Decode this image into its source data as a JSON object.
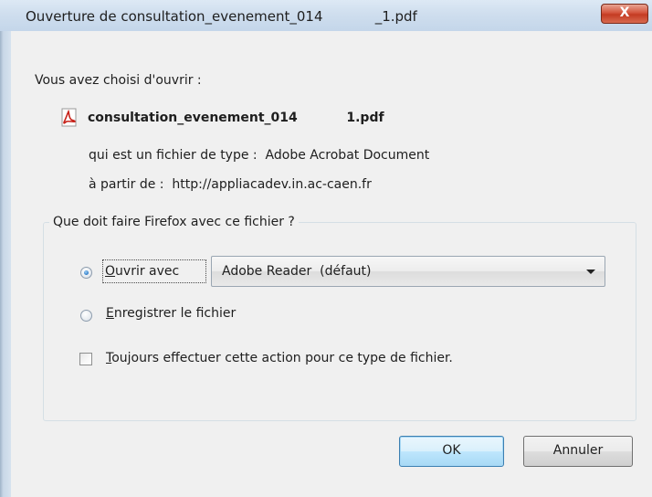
{
  "window": {
    "title": "Ouverture de consultation_evenement_014            _1.pdf",
    "close_glyph": "X"
  },
  "info": {
    "chosen_label": "Vous avez choisi d'ouvrir :",
    "file_icon": "pdf-icon",
    "filename": "consultation_evenement_014           1.pdf",
    "type_line": "qui est un fichier de type :  Adobe Acrobat Document",
    "from_line": "à partir de :  http://appliacadev.in.ac-caen.fr"
  },
  "action_group": {
    "legend": "Que doit faire Firefox avec ce fichier ?",
    "open_with": {
      "accel": "O",
      "rest": "uvrir avec",
      "checked": true
    },
    "application": "Adobe Reader  (défaut)",
    "save_file": {
      "accel": "E",
      "rest": "nregistrer le fichier",
      "checked": false
    },
    "always_do": {
      "accel": "T",
      "rest": "oujours effectuer cette action pour ce type de fichier.",
      "checked": false
    }
  },
  "buttons": {
    "ok": "OK",
    "cancel": "Annuler"
  },
  "colors": {
    "pdf_red": "#c8231b",
    "client_bg": "#f0f0f0",
    "close_red": "#c43b22"
  }
}
